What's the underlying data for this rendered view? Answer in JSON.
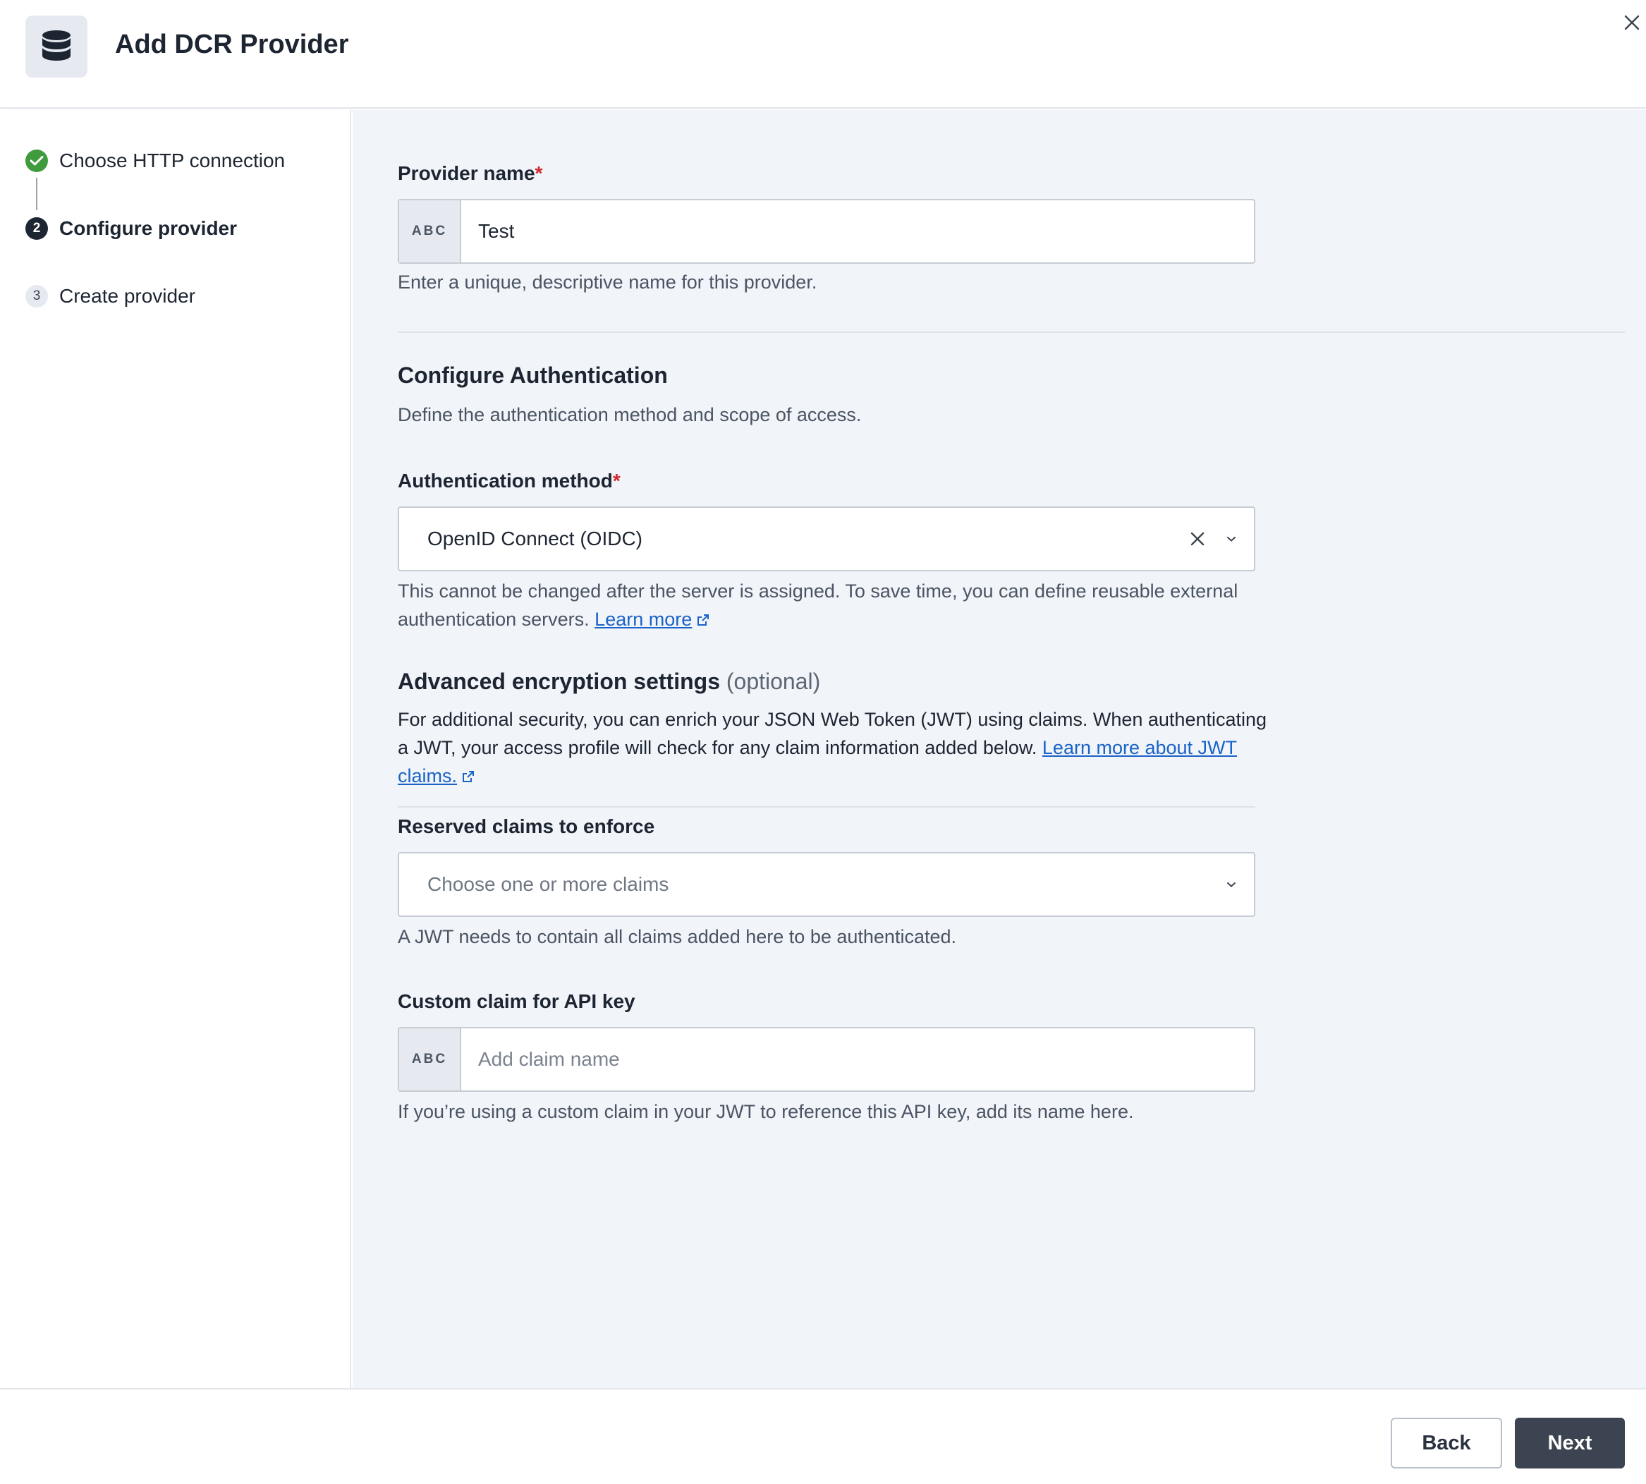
{
  "header": {
    "title": "Add DCR Provider",
    "icon": "database-icon"
  },
  "steps": [
    {
      "number": "1",
      "label": "Choose HTTP connection",
      "state": "complete"
    },
    {
      "number": "2",
      "label": "Configure provider",
      "state": "active"
    },
    {
      "number": "3",
      "label": "Create provider",
      "state": "upcoming"
    }
  ],
  "form": {
    "provider_name": {
      "label": "Provider name",
      "required_mark": "*",
      "prefix": "ABC",
      "value": "Test",
      "help": "Enter a unique, descriptive name for this provider."
    },
    "auth_section": {
      "title": "Configure Authentication",
      "description": "Define the authentication method and scope of access."
    },
    "auth_method": {
      "label": "Authentication method",
      "required_mark": "*",
      "value": "OpenID Connect (OIDC)",
      "help": "This cannot be changed after the server is assigned. To save time, you can define reusable external authentication servers.",
      "link": "Learn more"
    },
    "advanced": {
      "title": "Advanced encryption settings",
      "optional": "(optional)",
      "description": "For additional security, you can enrich your JSON Web Token (JWT) using claims. When authenticating a JWT, your access profile will check for any claim information added below.",
      "link": "Learn more about JWT claims."
    },
    "reserved_claims": {
      "label": "Reserved claims to enforce",
      "placeholder": "Choose one or more claims",
      "help": "A JWT needs to contain all claims added here to be authenticated."
    },
    "custom_claim": {
      "label": "Custom claim for API key",
      "prefix": "ABC",
      "placeholder": "Add claim name",
      "help": "If you’re using a custom claim in your JWT to reference this API key, add its name here."
    }
  },
  "footer": {
    "back_label": "Back",
    "next_label": "Next"
  },
  "colors": {
    "accent_dark": "#3b4450",
    "success": "#3f9b3c",
    "required": "#d1282e",
    "link": "#1a63c8",
    "main_bg": "#f1f4f8"
  }
}
